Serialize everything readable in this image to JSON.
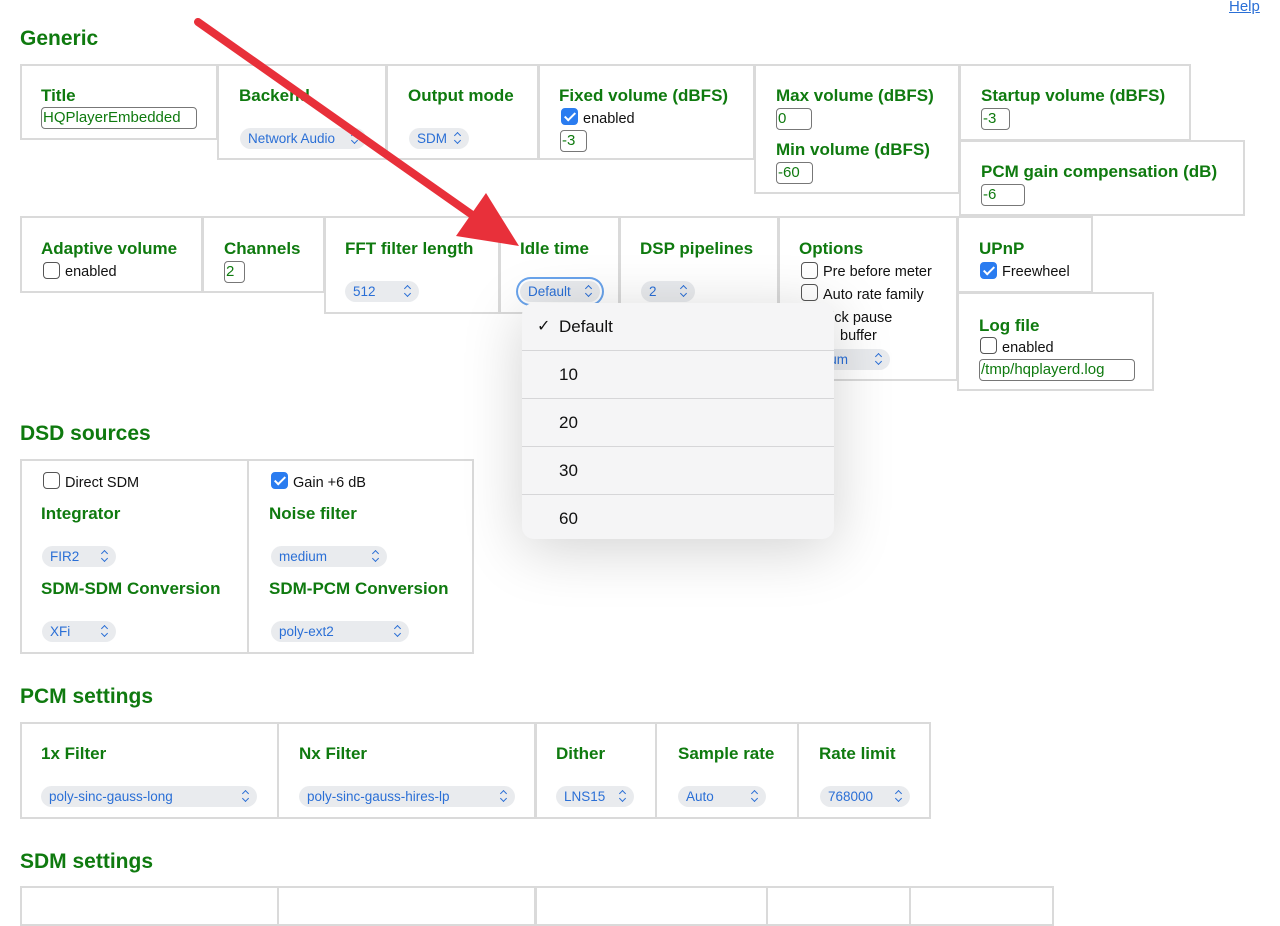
{
  "help_link": "Help",
  "sections": {
    "generic": "Generic",
    "dsd": "DSD sources",
    "pcm": "PCM settings",
    "sdm": "SDM settings"
  },
  "generic": {
    "title_label": "Title",
    "title_value": "HQPlayerEmbedded",
    "backend_label": "Backend",
    "backend_value": "Network Audio",
    "output_mode_label": "Output mode",
    "output_mode_value": "SDM",
    "fixed_volume_label": "Fixed volume (dBFS)",
    "fixed_volume_enabled": "enabled",
    "fixed_volume_value": "-3",
    "max_volume_label": "Max volume (dBFS)",
    "max_volume_value": "0",
    "min_volume_label": "Min volume (dBFS)",
    "min_volume_value": "-60",
    "startup_volume_label": "Startup volume (dBFS)",
    "startup_volume_value": "-3",
    "pcm_gain_label": "PCM gain compensation (dB)",
    "pcm_gain_value": "-6",
    "adaptive_volume_label": "Adaptive volume",
    "adaptive_volume_enabled": "enabled",
    "channels_label": "Channels",
    "channels_value": "2",
    "fft_label": "FFT filter length",
    "fft_value": "512",
    "idle_label": "Idle time",
    "idle_value": "Default",
    "dsp_label": "DSP pipelines",
    "dsp_value": "2",
    "options_label": "Options",
    "opt_pre_meter": "Pre before meter",
    "opt_auto_rate": "Auto rate family",
    "opt_quick_pause_visible": "uick pause",
    "opt_buffer_visible": "buffer",
    "opt_select_visible": "mum",
    "upnp_label": "UPnP",
    "upnp_freewheel": "Freewheel",
    "logfile_label": "Log file",
    "logfile_enabled": "enabled",
    "logfile_value": "/tmp/hqplayerd.log"
  },
  "idle_dropdown": {
    "options": [
      "Default",
      "10",
      "20",
      "30",
      "60"
    ],
    "selected": "Default",
    "check": "✓"
  },
  "dsd": {
    "direct_sdm": "Direct SDM",
    "gain": "Gain +6 dB",
    "integrator_label": "Integrator",
    "integrator_value": "FIR2",
    "noise_filter_label": "Noise filter",
    "noise_filter_value": "medium",
    "sdm_sdm_label": "SDM-SDM Conversion",
    "sdm_sdm_value": "XFi",
    "sdm_pcm_label": "SDM-PCM Conversion",
    "sdm_pcm_value": "poly-ext2"
  },
  "pcm": {
    "filter1x_label": "1x Filter",
    "filter1x_value": "poly-sinc-gauss-long",
    "filternx_label": "Nx Filter",
    "filternx_value": "poly-sinc-gauss-hires-lp",
    "dither_label": "Dither",
    "dither_value": "LNS15",
    "sample_rate_label": "Sample rate",
    "sample_rate_value": "Auto",
    "rate_limit_label": "Rate limit",
    "rate_limit_value": "768000"
  },
  "colors": {
    "label_green": "#0f7a0f",
    "link_blue": "#2a6fd6",
    "arrow_red": "#e8303a",
    "checkbox_blue": "#2a7cf0"
  }
}
